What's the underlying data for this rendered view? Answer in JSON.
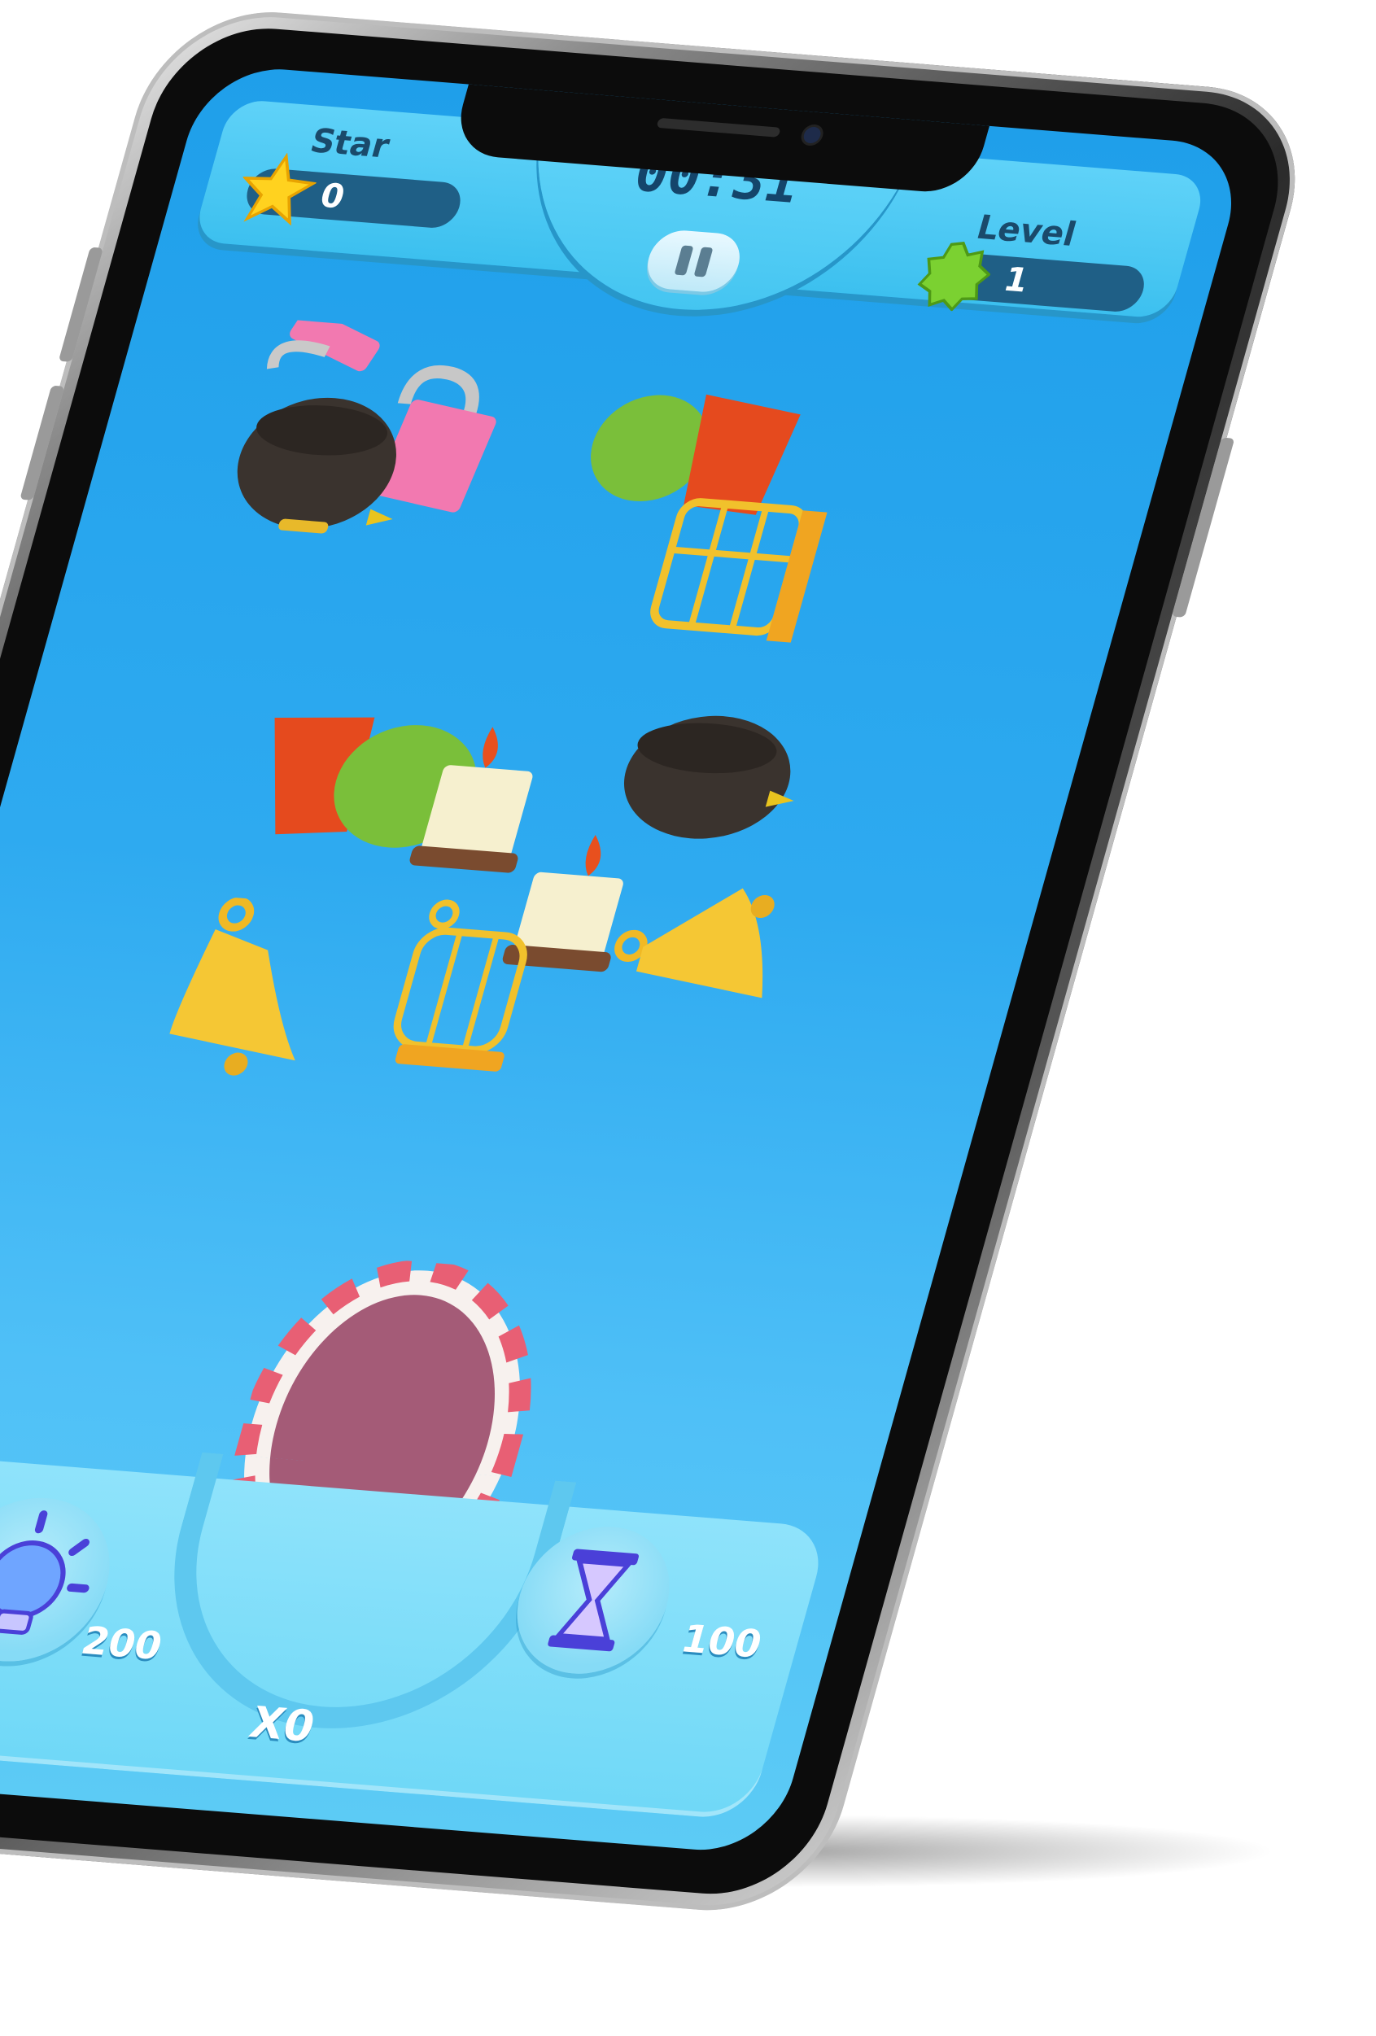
{
  "hud": {
    "star_label": "Star",
    "star_value": "0",
    "timer": "00:31",
    "level_label": "Level",
    "level_value": "1"
  },
  "boosters": {
    "hint_cost": "200",
    "time_cost": "100",
    "multiplier": "X0"
  },
  "icons": {
    "star": "star-icon",
    "level": "level-badge-icon",
    "pause": "pause-icon",
    "hint": "lightbulb-icon",
    "time": "hourglass-icon"
  },
  "items": [
    "padlock",
    "cauldron",
    "cactus-pot",
    "bird-cage",
    "cactus-pot",
    "candle",
    "cauldron",
    "candle",
    "bell",
    "bird-cage",
    "bell",
    "padlock"
  ],
  "colors": {
    "screen_top": "#1f9fea",
    "screen_bottom": "#5ccbf5",
    "hud": "#44c5f1",
    "pill": "#1f5f86",
    "basket_rim": "#e85f74",
    "basket_inner": "#a45b77"
  }
}
